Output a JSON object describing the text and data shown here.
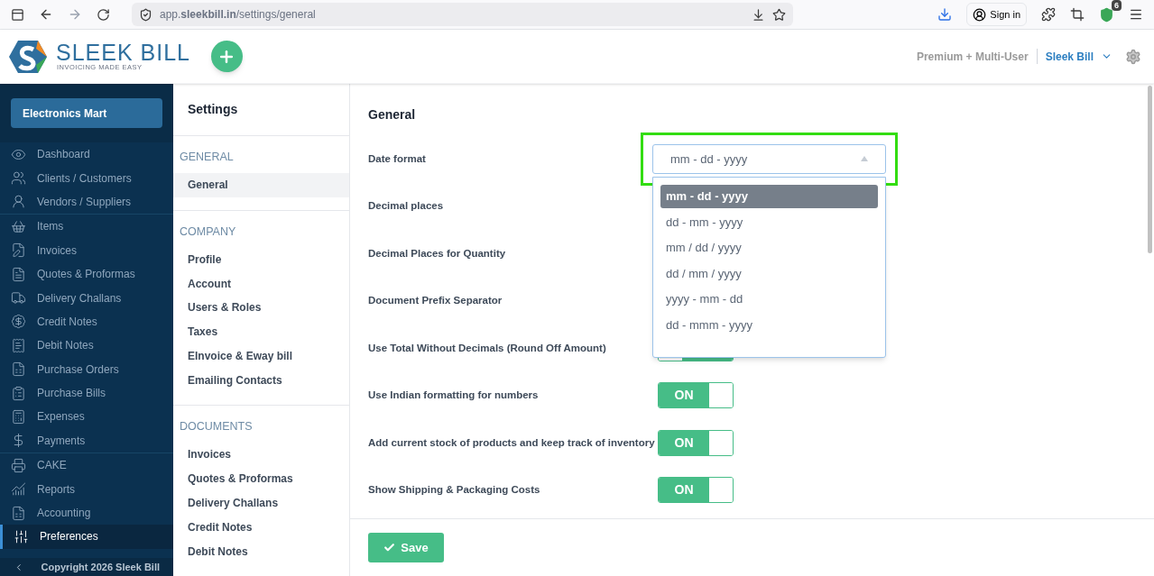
{
  "browser": {
    "url": "app.**sleekbill.in**/settings/general",
    "sign_in": "Sign in",
    "extension_badge": "6"
  },
  "header": {
    "logo_name": "SLEEK BILL",
    "logo_tagline": "INVOICING MADE EASY",
    "plan": "Premium + Multi-User",
    "account": "Sleek Bill"
  },
  "sidebar": {
    "company": "Electronics Mart",
    "groups": [
      [
        {
          "label": "Dashboard",
          "selected": false
        },
        {
          "label": "Clients / Customers",
          "selected": false
        },
        {
          "label": "Vendors / Suppliers",
          "selected": false
        }
      ],
      [
        {
          "label": "Items",
          "selected": false
        },
        {
          "label": "Invoices",
          "selected": false
        },
        {
          "label": "Quotes & Proformas",
          "selected": false
        },
        {
          "label": "Delivery Challans",
          "selected": false
        },
        {
          "label": "Credit Notes",
          "selected": false
        },
        {
          "label": "Debit Notes",
          "selected": false
        },
        {
          "label": "Purchase Orders",
          "selected": false
        },
        {
          "label": "Purchase Bills",
          "selected": false
        },
        {
          "label": "Expenses",
          "selected": false
        },
        {
          "label": "Payments",
          "selected": false
        }
      ],
      [
        {
          "label": "CAKE",
          "selected": false
        },
        {
          "label": "Reports",
          "selected": false
        },
        {
          "label": "Accounting",
          "selected": false
        },
        {
          "label": "Preferences",
          "selected": true
        }
      ]
    ],
    "footer": "Copyright 2026 Sleek Bill"
  },
  "settings_nav": {
    "title": "Settings",
    "sections": [
      {
        "heading": "GENERAL",
        "items": [
          {
            "label": "General",
            "selected": true
          }
        ]
      },
      {
        "heading": "COMPANY",
        "items": [
          {
            "label": "Profile",
            "selected": false
          },
          {
            "label": "Account",
            "selected": false
          },
          {
            "label": "Users & Roles",
            "selected": false
          },
          {
            "label": "Taxes",
            "selected": false
          },
          {
            "label": "EInvoice & Eway bill",
            "selected": false
          },
          {
            "label": "Emailing Contacts",
            "selected": false
          }
        ]
      },
      {
        "heading": "DOCUMENTS",
        "items": [
          {
            "label": "Invoices",
            "selected": false
          },
          {
            "label": "Quotes & Proformas",
            "selected": false
          },
          {
            "label": "Delivery Challans",
            "selected": false
          },
          {
            "label": "Credit Notes",
            "selected": false
          },
          {
            "label": "Debit Notes",
            "selected": false
          }
        ]
      }
    ]
  },
  "general": {
    "title": "General",
    "rows": [
      {
        "label": "Date format",
        "kind": "select",
        "value": "mm - dd - yyyy",
        "expanded": true,
        "outlined": true,
        "options": [
          {
            "label": "mm - dd - yyyy",
            "selected": true
          },
          {
            "label": "dd - mm - yyyy",
            "selected": false
          },
          {
            "label": "mm / dd / yyyy",
            "selected": false
          },
          {
            "label": "dd / mm / yyyy",
            "selected": false
          },
          {
            "label": "yyyy - mm - dd",
            "selected": false
          },
          {
            "label": "dd - mmm - yyyy",
            "selected": false
          }
        ]
      },
      {
        "label": "Decimal places",
        "kind": "label"
      },
      {
        "label": "Decimal Places for Quantity",
        "kind": "label"
      },
      {
        "label": "Document Prefix Separator",
        "kind": "label"
      },
      {
        "label": "Use Total Without Decimals (Round Off Amount)",
        "kind": "toggle",
        "on": true
      },
      {
        "label": "Use Indian formatting for numbers",
        "kind": "toggle",
        "on": true,
        "text": "ON"
      },
      {
        "label": "Add current stock of products and keep track of inventory",
        "kind": "toggle",
        "on": true,
        "text": "ON"
      },
      {
        "label": "Show Shipping & Packaging Costs",
        "kind": "toggle",
        "on": true,
        "text": "ON"
      }
    ]
  },
  "save": "Save"
}
